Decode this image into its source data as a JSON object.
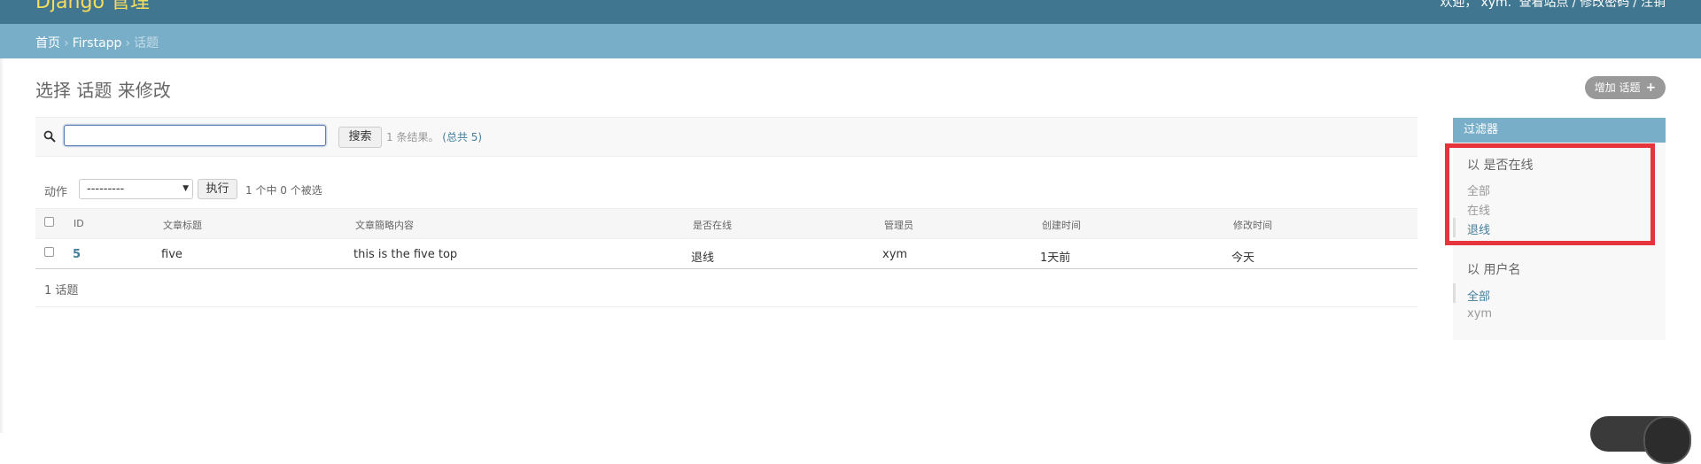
{
  "header": {
    "brand": "Django 管理",
    "user_tools": [
      "欢迎，",
      "xym.",
      "查看站点",
      "/",
      "修改密码",
      "/",
      "注销"
    ]
  },
  "breadcrumbs": {
    "home": "首页",
    "app": "Firstapp",
    "current": "话题",
    "separator": "›"
  },
  "page": {
    "title": "选择 话题 来修改",
    "add_label": "增加 话题",
    "add_icon": "plus-icon"
  },
  "search": {
    "value": "",
    "button_label": "搜索",
    "result_text": "1 条结果。",
    "total_text": "(总共 5)"
  },
  "actions": {
    "label": "动作",
    "selected_option": "---------",
    "go_label": "执行",
    "counter": "1 个中 0 个被选"
  },
  "table": {
    "columns": [
      "ID",
      "文章标题",
      "文章簡略内容",
      "是否在线",
      "管理员",
      "创建时间",
      "修改时间"
    ],
    "rows": [
      [
        "5",
        "five",
        "this is the five top",
        "退线",
        "xym",
        "1天前",
        "今天"
      ]
    ],
    "count_text": "1 话题"
  },
  "filter": {
    "title": "过滤器",
    "groups": [
      {
        "title": "以 是否在线",
        "options": [
          "全部",
          "在线",
          "退线"
        ],
        "selected": 2
      },
      {
        "title": "以 用户名",
        "options": [
          "全部",
          "xym"
        ],
        "selected": 0
      }
    ]
  },
  "colors": {
    "header": "#417690",
    "breadcrumb": "#79aec8",
    "brand": "#f5dd5d",
    "link": "#447e9b",
    "highlight": "#e5343c"
  }
}
